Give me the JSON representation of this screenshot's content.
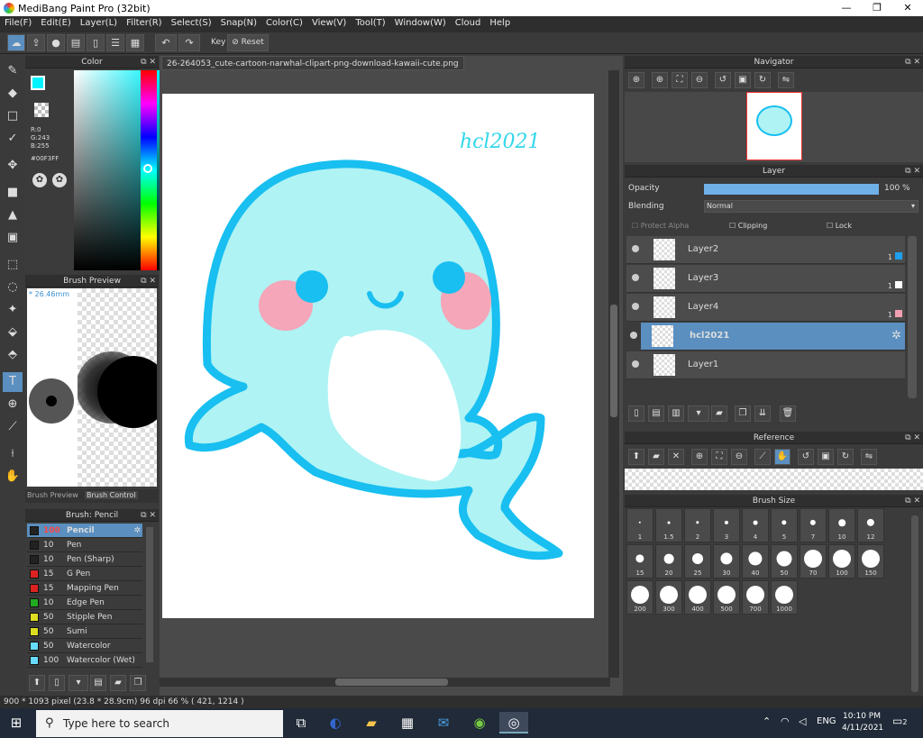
{
  "window": {
    "title": "MediBang Paint Pro (32bit)",
    "minimize": "—",
    "maximize": "❐",
    "close": "✕"
  },
  "menu": [
    "File(F)",
    "Edit(E)",
    "Layer(L)",
    "Filter(R)",
    "Select(S)",
    "Snap(N)",
    "Color(C)",
    "View(V)",
    "Tool(T)",
    "Window(W)",
    "Cloud",
    "Help"
  ],
  "toolbar": {
    "key_label": "Key",
    "reset_label": "Reset"
  },
  "color_panel": {
    "title": "Color",
    "r": "R:0",
    "g": "G:243",
    "b": "B:255",
    "hex": "#00F3FF",
    "main_color": "#00f3ff"
  },
  "brush_preview": {
    "title": "Brush Preview",
    "size": "* 26.46mm",
    "tab1": "Brush Preview",
    "tab2": "Brush Control"
  },
  "brush_panel": {
    "title": "Brush: Pencil",
    "brushes": [
      {
        "size": "100",
        "name": "Pencil",
        "color": "#222222",
        "selected": true
      },
      {
        "size": "10",
        "name": "Pen",
        "color": "#222222"
      },
      {
        "size": "10",
        "name": "Pen (Sharp)",
        "color": "#222222"
      },
      {
        "size": "15",
        "name": "G Pen",
        "color": "#dd2222"
      },
      {
        "size": "15",
        "name": "Mapping Pen",
        "color": "#dd2222"
      },
      {
        "size": "10",
        "name": "Edge Pen",
        "color": "#22aa22"
      },
      {
        "size": "50",
        "name": "Stipple Pen",
        "color": "#dddd22"
      },
      {
        "size": "50",
        "name": "Sumi",
        "color": "#dddd22"
      },
      {
        "size": "50",
        "name": "Watercolor",
        "color": "#66ddff"
      },
      {
        "size": "100",
        "name": "Watercolor (Wet)",
        "color": "#66ddff"
      }
    ]
  },
  "document": {
    "tab": "26-264053_cute-cartoon-narwhal-clipart-png-download-kawaii-cute.png",
    "signature": "hcl2021"
  },
  "navigator": {
    "title": "Navigator"
  },
  "layer_panel": {
    "title": "Layer",
    "opacity_label": "Opacity",
    "opacity_value": "100 %",
    "opacity": 1.0,
    "blending_label": "Blending",
    "blending_value": "Normal",
    "protect_alpha": "Protect Alpha",
    "clipping": "Clipping",
    "lock": "Lock",
    "layers": [
      {
        "name": "Layer2",
        "swatch": "#1ea0f0",
        "count": "1"
      },
      {
        "name": "Layer3",
        "swatch": "#ffffff",
        "count": "1"
      },
      {
        "name": "Layer4",
        "swatch": "#f0a0b0",
        "count": "1"
      },
      {
        "name": "hcl2021",
        "selected": true
      },
      {
        "name": "Layer1"
      }
    ]
  },
  "reference": {
    "title": "Reference"
  },
  "brush_size": {
    "title": "Brush Size",
    "sizes": [
      "1",
      "1.5",
      "2",
      "3",
      "4",
      "5",
      "7",
      "10",
      "12",
      "15",
      "20",
      "25",
      "30",
      "40",
      "50",
      "70",
      "100",
      "150",
      "200",
      "300",
      "400",
      "500",
      "700",
      "1000"
    ]
  },
  "status": {
    "text": "900 * 1093 pixel  (23.8 * 28.9cm)  96 dpi  66 %  ( 421, 1214 )"
  },
  "taskbar": {
    "search_placeholder": "Type here to search",
    "lang": "ENG",
    "time": "10:10 PM",
    "date": "4/11/2021",
    "notif_count": "2"
  }
}
